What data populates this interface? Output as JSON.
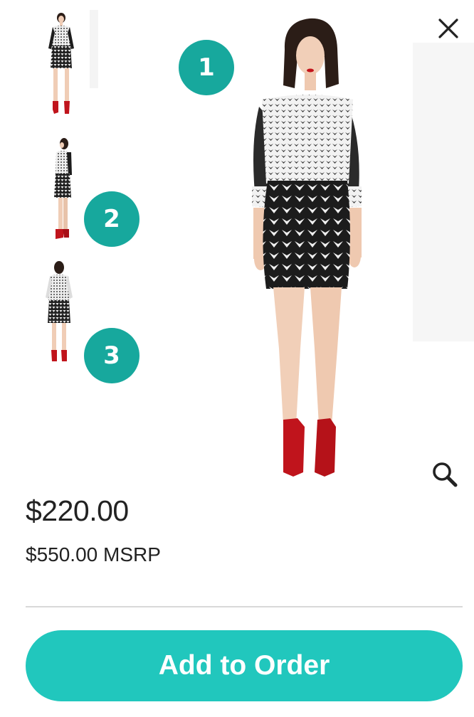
{
  "gallery": {
    "thumbnails": [
      {
        "view": "front",
        "badge": "1"
      },
      {
        "view": "side",
        "badge": "2"
      },
      {
        "view": "back",
        "badge": "3"
      }
    ],
    "badge_color": "#17a89d"
  },
  "product": {
    "price": "$220.00",
    "msrp": "$550.00 MSRP",
    "dress_pattern": "black and white geometric print",
    "boot_color": "#c0141c"
  },
  "actions": {
    "close_icon": "close-icon",
    "zoom_icon": "magnifier-icon",
    "add_to_order": "Add to Order",
    "button_color": "#21c7bd"
  }
}
